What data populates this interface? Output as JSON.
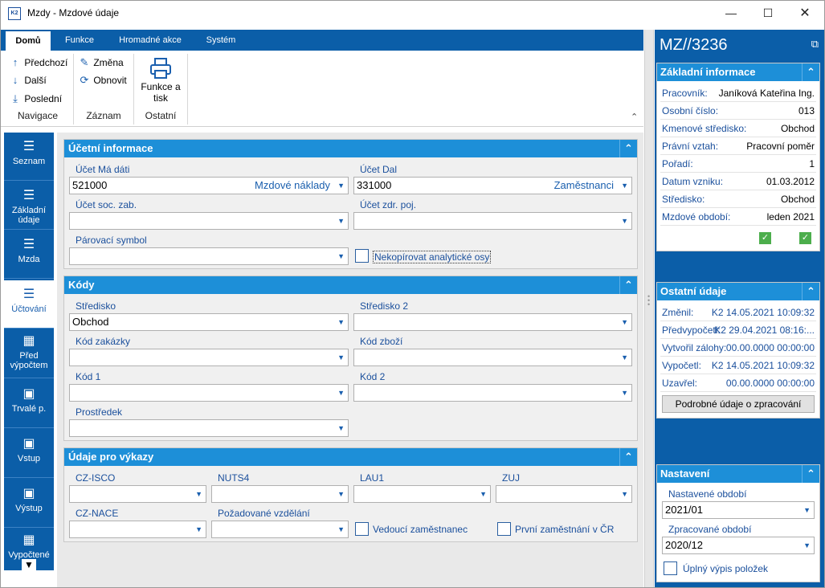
{
  "window": {
    "title": "Mzdy - Mzdové údaje",
    "icon_label": "K2",
    "controls": [
      "minimize-icon",
      "maximize-icon",
      "close-icon"
    ]
  },
  "ribbon": {
    "tabs": [
      {
        "label": "Domů",
        "active": true
      },
      {
        "label": "Funkce",
        "active": false
      },
      {
        "label": "Hromadné akce",
        "active": false
      },
      {
        "label": "Systém",
        "active": false
      }
    ],
    "navigace": {
      "group_label": "Navigace",
      "items": [
        {
          "label": "Předchozí",
          "icon": "arrow-up-icon"
        },
        {
          "label": "Další",
          "icon": "arrow-down-icon"
        },
        {
          "label": "Poslední",
          "icon": "arrow-last-icon"
        }
      ]
    },
    "zaznam": {
      "group_label": "Záznam",
      "items": [
        {
          "label": "Změna",
          "icon": "pencil-icon"
        },
        {
          "label": "Obnovit",
          "icon": "refresh-icon"
        }
      ]
    },
    "ostatni": {
      "group_label": "Ostatní",
      "print_label_1": "Funkce a",
      "print_label_2": "tisk"
    }
  },
  "nav": {
    "items": [
      {
        "label": "Seznam",
        "label2": "",
        "active": false
      },
      {
        "label": "Základní",
        "label2": "údaje",
        "active": false
      },
      {
        "label": "Mzda",
        "label2": "",
        "active": false
      },
      {
        "label": "Účtování",
        "label2": "",
        "active": true
      },
      {
        "label": "Před",
        "label2": "výpočtem",
        "active": false
      },
      {
        "label": "Trvalé p.",
        "label2": "",
        "active": false
      },
      {
        "label": "Vstup",
        "label2": "",
        "active": false
      },
      {
        "label": "Výstup",
        "label2": "",
        "active": false
      },
      {
        "label": "Vypočtené",
        "label2": "",
        "active": false
      }
    ]
  },
  "ucetni": {
    "title": "Účetní informace",
    "ucet_ma_dati_label": "Účet Má dáti",
    "ucet_ma_dati_value": "521000",
    "ucet_ma_dati_desc": "Mzdové náklady",
    "ucet_dal_label": "Účet Dal",
    "ucet_dal_value": "331000",
    "ucet_dal_desc": "Zaměstnanci",
    "soc_label": "Účet soc. zab.",
    "zdr_label": "Účet zdr. poj.",
    "parovaci_label": "Párovací symbol",
    "nekopirovat_label": "Nekopírovat analytické osy"
  },
  "kody": {
    "title": "Kódy",
    "stredisko_label": "Středisko",
    "stredisko_value": "Obchod",
    "stredisko2_label": "Středisko 2",
    "zakazka_label": "Kód zakázky",
    "zbozi_label": "Kód zboží",
    "kod1_label": "Kód 1",
    "kod2_label": "Kód 2",
    "prostredek_label": "Prostředek"
  },
  "vykazy": {
    "title": "Údaje pro výkazy",
    "cz_isco_label": "CZ-ISCO",
    "nuts4_label": "NUTS4",
    "lau1_label": "LAU1",
    "zuj_label": "ZUJ",
    "cz_nace_label": "CZ-NACE",
    "vzdelani_label": "Požadované vzdělání",
    "vedouci_label": "Vedoucí zaměstnanec",
    "prvni_label": "První zaměstnání v ČR"
  },
  "right": {
    "doc_id": "MZ//3236",
    "zakladni": {
      "title": "Základní informace",
      "rows": [
        {
          "k": "Pracovník:",
          "v": "Janíková Kateřina Ing."
        },
        {
          "k": "Osobní číslo:",
          "v": "013"
        },
        {
          "k": "Kmenové středisko:",
          "v": "Obchod"
        },
        {
          "k": "Právní vztah:",
          "v": "Pracovní poměr"
        },
        {
          "k": "Pořadí:",
          "v": "1"
        },
        {
          "k": "Datum vzniku:",
          "v": "01.03.2012"
        },
        {
          "k": "Středisko:",
          "v": "Obchod"
        },
        {
          "k": "Mzdové období:",
          "v": "leden 2021"
        }
      ]
    },
    "ostatni": {
      "title": "Ostatní údaje",
      "rows": [
        {
          "k": "Změnil:",
          "v": "K2 14.05.2021 10:09:32"
        },
        {
          "k": "Předvypočetl:",
          "v": "K2 29.04.2021 08:16:..."
        },
        {
          "k": "Vytvořil zálohy:",
          "v": "00.00.0000 00:00:00"
        },
        {
          "k": "Vypočetl:",
          "v": "K2 14.05.2021 10:09:32"
        },
        {
          "k": "Uzavřel:",
          "v": "00.00.0000 00:00:00"
        }
      ],
      "detail_button": "Podrobné údaje o zpracování"
    },
    "nastaveni": {
      "title": "Nastavení",
      "nastavene_label": "Nastavené období",
      "nastavene_value": "2021/01",
      "zpracovane_label": "Zpracované období",
      "zpracovane_value": "2020/12",
      "uplny_label": "Úplný výpis položek"
    }
  }
}
